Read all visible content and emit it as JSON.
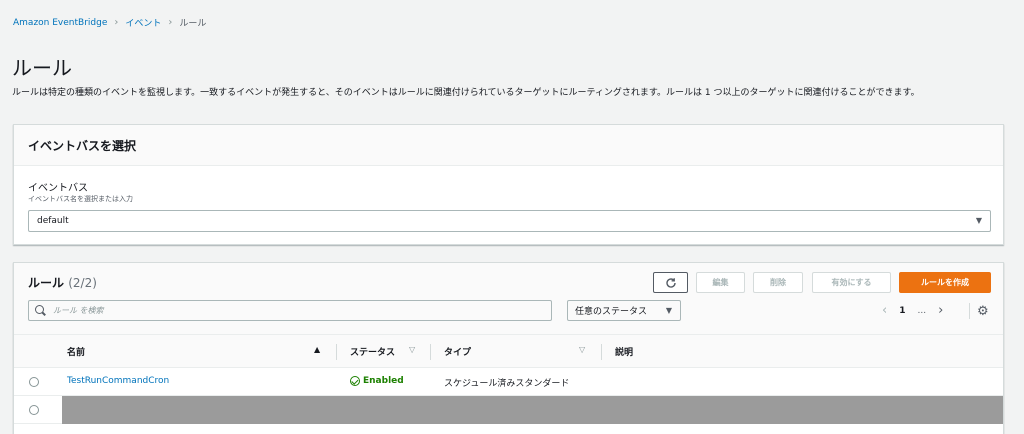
{
  "breadcrumb": {
    "items": [
      "Amazon EventBridge",
      "イベント",
      "ルール"
    ]
  },
  "page": {
    "title": "ルール",
    "description": "ルールは特定の種類のイベントを監視します。一致するイベントが発生すると、そのイベントはルールに関連付けられているターゲットにルーティングされます。ルールは 1 つ以上のターゲットに関連付けることができます。"
  },
  "event_bus_panel": {
    "header": "イベントバスを選択",
    "field_label": "イベントバス",
    "field_hint": "イベントバス名を選択または入力",
    "selected_value": "default"
  },
  "rules_panel": {
    "title": "ルール",
    "count": "(2/2)",
    "buttons": {
      "edit": "編集",
      "delete": "削除",
      "enable": "有効にする",
      "create": "ルールを作成"
    },
    "search_placeholder": "ルール を検索",
    "status_filter": "任意のステータス",
    "pager": {
      "page": "1",
      "ellipsis": "..."
    },
    "columns": {
      "name": "名前",
      "status": "ステータス",
      "type": "タイプ",
      "description": "説明"
    },
    "rows": [
      {
        "name": "TestRunCommandCron",
        "status": "Enabled",
        "type": "スケジュール済みスタンダード"
      }
    ]
  },
  "colors": {
    "link": "#0073bb",
    "primary_button": "#ec7211",
    "status_enabled": "#1d8102",
    "redaction": "#9b9b9b"
  },
  "icons": [
    "chevron-right-icon",
    "caret-down-icon",
    "refresh-icon",
    "search-icon",
    "chevron-left-icon",
    "settings-gear-icon",
    "sort-ascending-icon",
    "sort-icon",
    "check-circle-icon",
    "radio-icon"
  ]
}
